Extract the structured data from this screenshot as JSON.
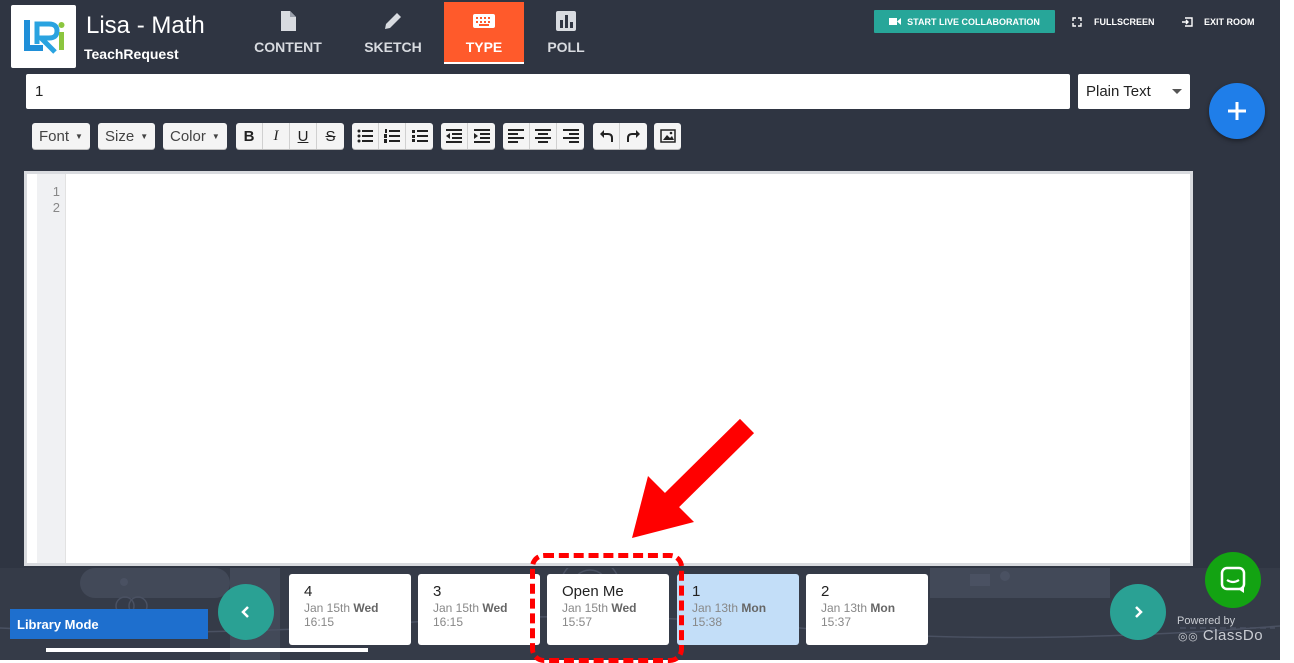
{
  "header": {
    "room_title": "Lisa - Math",
    "room_subtitle": "TeachRequest",
    "tabs": [
      {
        "label": "CONTENT",
        "icon": "document-icon"
      },
      {
        "label": "SKETCH",
        "icon": "pencil-icon"
      },
      {
        "label": "TYPE",
        "icon": "keyboard-icon",
        "active": true
      },
      {
        "label": "POLL",
        "icon": "bar-chart-icon"
      }
    ],
    "live_collab_label": "START LIVE COLLABORATION",
    "fullscreen_label": "FULLSCREEN",
    "exit_label": "EXIT ROOM"
  },
  "editor": {
    "title_value": "1",
    "mode_selected": "Plain Text",
    "line_numbers": [
      "1",
      "2"
    ]
  },
  "toolbar": {
    "font_label": "Font",
    "size_label": "Size",
    "color_label": "Color"
  },
  "bottom": {
    "library_mode_label": "Library Mode",
    "cards": [
      {
        "title": "4",
        "date": "Jan 15th",
        "day": "Wed",
        "time": "16:15"
      },
      {
        "title": "3",
        "date": "Jan 15th",
        "day": "Wed",
        "time": "16:15"
      },
      {
        "title": "Open Me",
        "date": "Jan 15th",
        "day": "Wed",
        "time": "15:57"
      },
      {
        "title": "1",
        "date": "Jan 13th",
        "day": "Mon",
        "time": "15:38",
        "selected": true
      },
      {
        "title": "2",
        "date": "Jan 13th",
        "day": "Mon",
        "time": "15:37"
      }
    ],
    "powered_by_label": "Powered by",
    "brand_label": "ClassDo"
  },
  "colors": {
    "background": "#2f3542",
    "active_tab": "#ff5a2b",
    "live_button": "#27a699",
    "add_button": "#1f7ee9",
    "chat_button": "#13a312",
    "annotation": "#ff0000"
  }
}
